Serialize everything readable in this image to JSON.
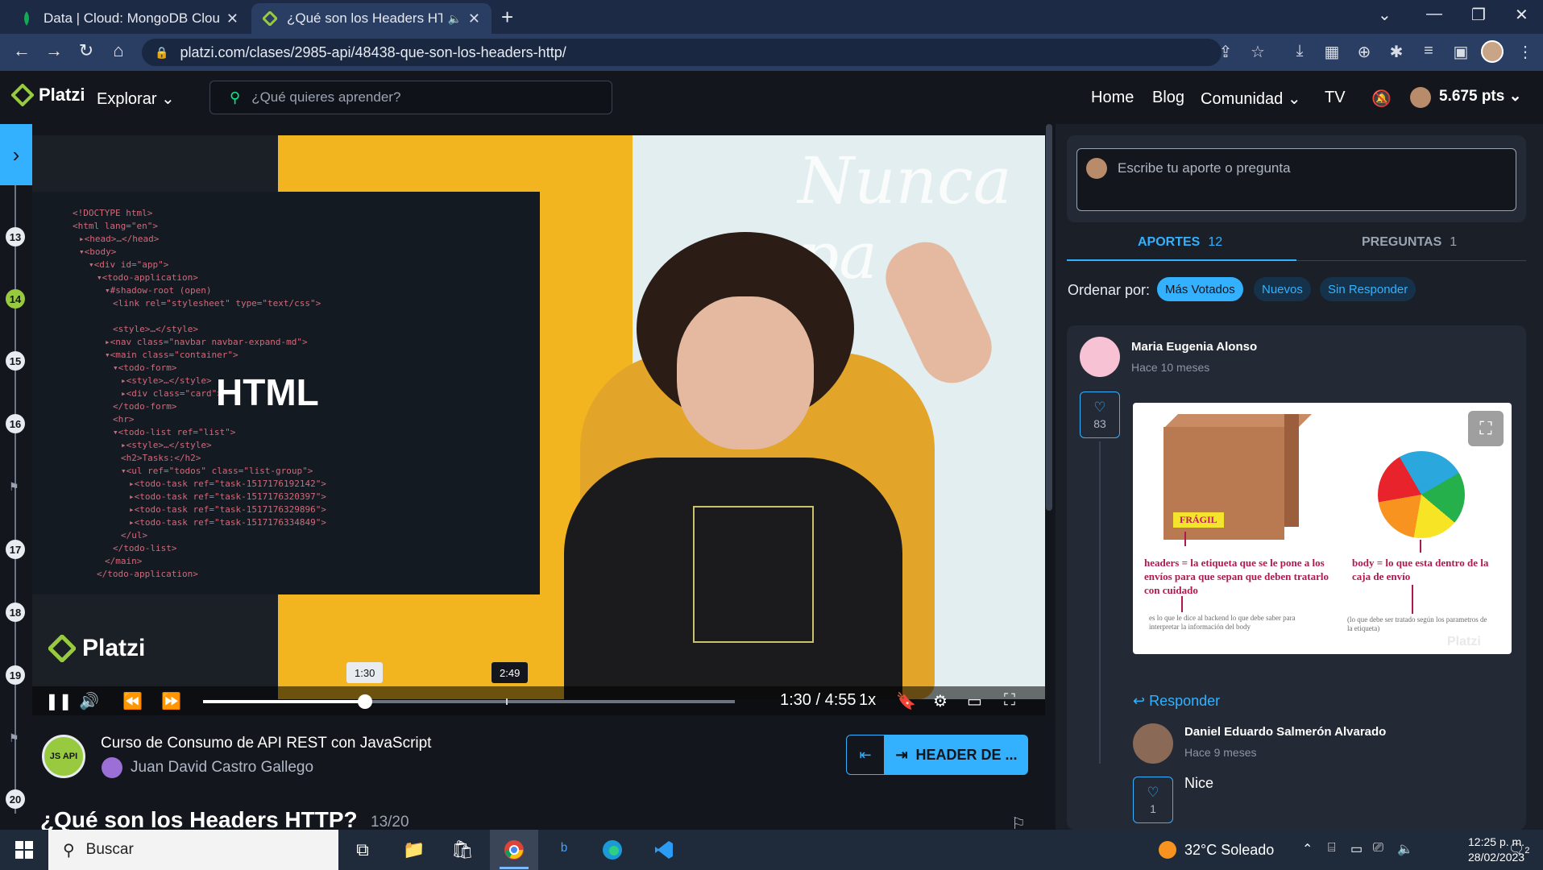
{
  "browser": {
    "tabs": [
      {
        "title": "Data | Cloud: MongoDB Cloud",
        "active": false
      },
      {
        "title": "¿Qué son los Headers HTTP?",
        "active": true
      }
    ],
    "url": "platzi.com/clases/2985-api/48438-que-son-los-headers-http/"
  },
  "header": {
    "brand": "Platzi",
    "explore": "Explorar",
    "search_placeholder": "¿Qué quieres aprender?",
    "nav": [
      "Home",
      "Blog",
      "Comunidad",
      "TV"
    ],
    "points": "5.675 pts"
  },
  "rail": {
    "numbers": [
      "13",
      "14",
      "15",
      "16",
      "17",
      "18",
      "19",
      "20"
    ],
    "current": "14"
  },
  "video": {
    "overlay_title": "HTML",
    "neon_text": "Nunca pa",
    "logo": "Platzi",
    "current_time": "1:30",
    "separator": "/",
    "duration": "4:55",
    "speed": "1x",
    "tooltip_current": "1:30",
    "tooltip_marker": "2:49",
    "progress_fraction": 0.305,
    "marker_fraction": 0.57
  },
  "course": {
    "icon_text": "JS API",
    "title": "Curso de Consumo de API REST con JavaScript",
    "teacher": "Juan David Castro Gallego",
    "next_label": "HEADER DE ...",
    "class_title": "¿Qué son los Headers HTTP?",
    "class_count": "13/20"
  },
  "discussion": {
    "ask_placeholder": "Escribe tu aporte o pregunta",
    "tabs": [
      {
        "label": "APORTES",
        "count": "12"
      },
      {
        "label": "PREGUNTAS",
        "count": "1"
      }
    ],
    "sort_label": "Ordenar por:",
    "sort_options": [
      "Más Votados",
      "Nuevos",
      "Sin Responder"
    ],
    "post": {
      "author": "Maria Eugenia Alonso",
      "time": "Hace 10 meses",
      "likes": "83",
      "image": {
        "badge": "FRÁGIL",
        "left_text": "headers = la etiqueta que se le pone a los envíos para que sepan que deben tratarlo con cuidado",
        "left_small": "es lo que le dice al backend lo que debe saber para interpretar la información del body",
        "right_text": "body = lo que esta dentro de la caja de envío",
        "right_small": "(lo que debe ser tratado según los parametros de la etiqueta)",
        "watermark": "Platzi"
      },
      "reply_label": "Responder"
    },
    "reply": {
      "author": "Daniel Eduardo Salmerón Alvarado",
      "time": "Hace 9 meses",
      "likes": "1",
      "text": "Nice"
    }
  },
  "taskbar": {
    "search": "Buscar",
    "weather": "32°C  Soleado",
    "time": "12:25 p. m.",
    "date": "28/02/2023",
    "notifications": "2"
  }
}
